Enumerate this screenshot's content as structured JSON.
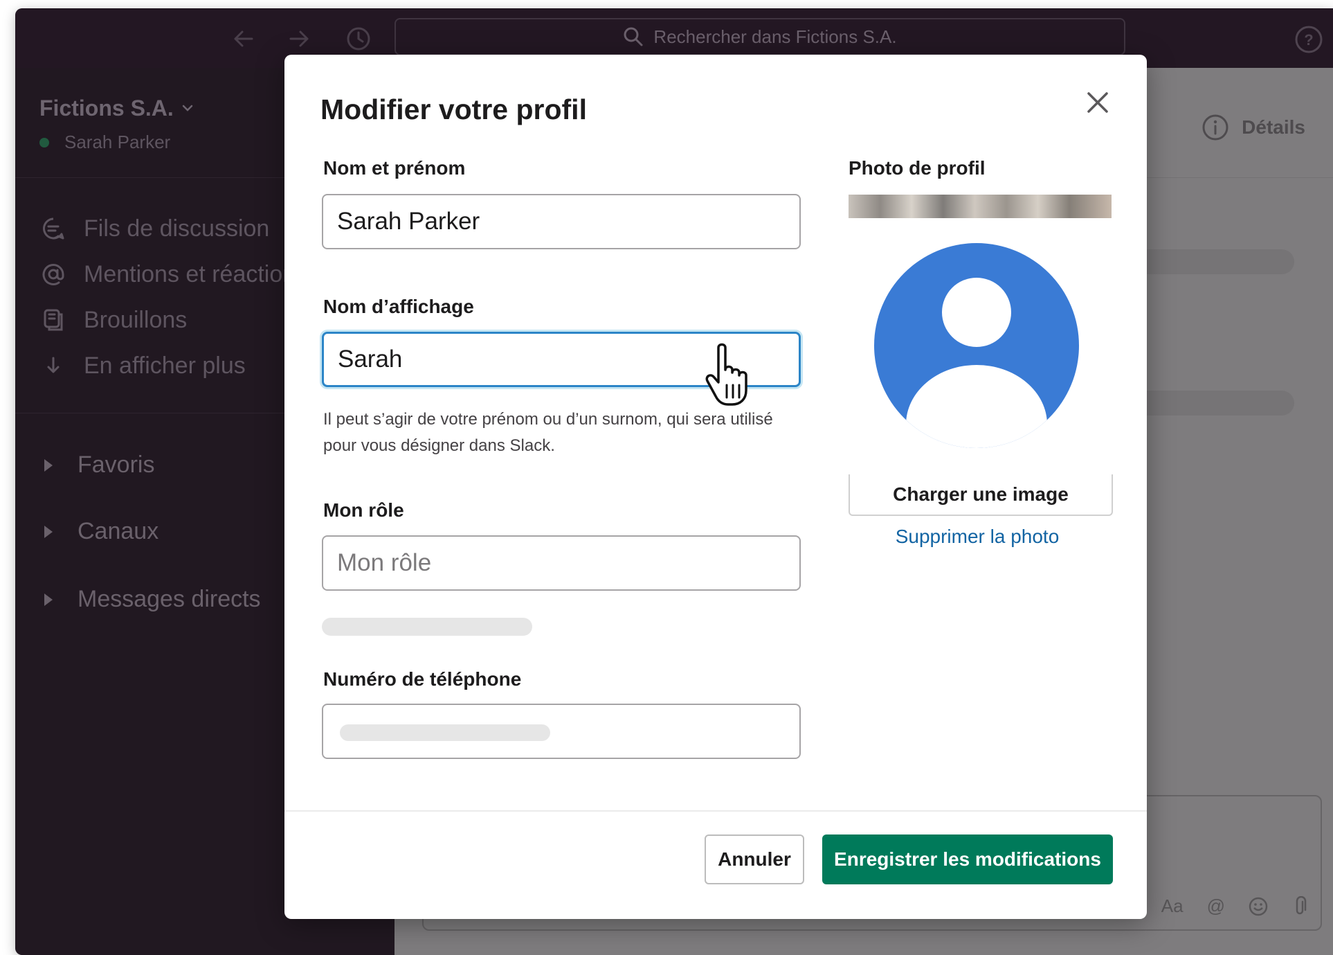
{
  "topbar": {
    "search_placeholder": "Rechercher dans Fictions S.A."
  },
  "sidebar": {
    "workspace_name": "Fictions S.A.",
    "user_name": "Sarah Parker",
    "items": [
      {
        "label": "Fils de discussion",
        "icon": "threads-icon"
      },
      {
        "label": "Mentions et réactions",
        "icon": "mention-icon"
      },
      {
        "label": "Brouillons",
        "icon": "drafts-icon"
      },
      {
        "label": "En afficher plus",
        "icon": "arrow-down-icon"
      }
    ],
    "sections": [
      {
        "label": "Favoris"
      },
      {
        "label": "Canaux"
      },
      {
        "label": "Messages directs"
      }
    ]
  },
  "channel_header": {
    "details_label": "Détails"
  },
  "composer": {
    "tools": [
      "Aa",
      "@",
      "emoji-icon",
      "attach-icon"
    ],
    "format_label": "Aa",
    "mention_label": "@"
  },
  "modal": {
    "title": "Modifier votre profil",
    "full_name": {
      "label": "Nom et prénom",
      "value": "Sarah Parker"
    },
    "display_name": {
      "label": "Nom d’affichage",
      "value": "Sarah",
      "hint": "Il peut s’agir de votre prénom ou d’un surnom, qui sera utilisé pour vous désigner dans Slack."
    },
    "role": {
      "label": "Mon rôle",
      "placeholder": "Mon rôle"
    },
    "phone": {
      "label": "Numéro de téléphone"
    },
    "photo": {
      "label": "Photo de profil",
      "upload_label": "Charger une image",
      "remove_label": "Supprimer la photo",
      "avatar_color": "#3a7bd5"
    },
    "footer": {
      "cancel_label": "Annuler",
      "save_label": "Enregistrer les modifications",
      "save_color": "#007a5a"
    }
  }
}
